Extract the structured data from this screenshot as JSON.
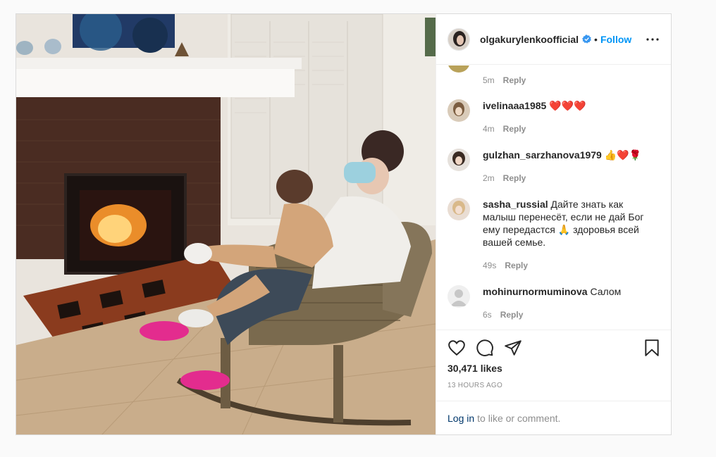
{
  "post": {
    "author": {
      "username": "olgakurylenkoofficial",
      "verified": true,
      "follow_label": "Follow",
      "separator": "•"
    },
    "comments": [
      {
        "username": "",
        "text": "",
        "time": "5m",
        "reply_label": "Reply"
      },
      {
        "username": "ivelinaaa1985",
        "text": "❤️❤️❤️",
        "time": "4m",
        "reply_label": "Reply"
      },
      {
        "username": "gulzhan_sarzhanova1979",
        "text": "👍❤️🌹",
        "time": "2m",
        "reply_label": "Reply"
      },
      {
        "username": "sasha_russial",
        "text": "Дайте знать как малыш перенесёт, если не дай Бог ему передастся 🙏 здоровья всей вашей семье.",
        "time": "49s",
        "reply_label": "Reply"
      },
      {
        "username": "mohinurnormuminova",
        "text": "Салом",
        "time": "6s",
        "reply_label": "Reply"
      }
    ],
    "actions": {
      "icons": [
        "heart-icon",
        "comment-icon",
        "share-icon",
        "bookmark-icon"
      ]
    },
    "likes": "30,471 likes",
    "time_ago": "13 HOURS AGO",
    "login": {
      "link_label": "Log in",
      "suffix": "to like or comment."
    }
  },
  "colors": {
    "accent": "#0095f6",
    "verified": "#3897f0",
    "heart": "#ed4956",
    "muted": "#8e8e8e"
  }
}
